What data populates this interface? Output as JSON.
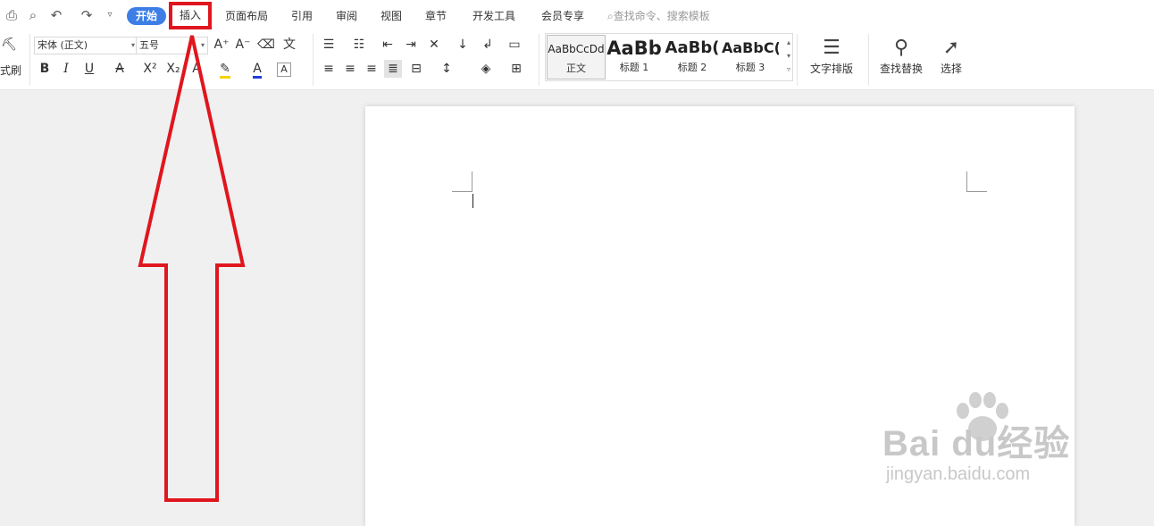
{
  "tabs": {
    "home": "开始",
    "insert": "插入",
    "layout": "页面布局",
    "reference": "引用",
    "review": "审阅",
    "view": "视图",
    "section": "章节",
    "devtools": "开发工具",
    "member": "会员专享"
  },
  "search": {
    "placeholder": "查找命令、搜索模板"
  },
  "ribbon": {
    "format_painter": "式刷",
    "font_name": "宋体 (正文)",
    "font_size": "五号",
    "styles": [
      {
        "preview": "AaBbCcDd",
        "name": "正文"
      },
      {
        "preview": "AaBb",
        "name": "标题 1"
      },
      {
        "preview": "AaBb(",
        "name": "标题 2"
      },
      {
        "preview": "AaBbC(",
        "name": "标题 3"
      }
    ],
    "text_layout": "文字排版",
    "find_replace": "查找替换",
    "select": "选择"
  },
  "watermark": {
    "logo_text": "Bai  du经验",
    "url": "jingyan.baidu.com"
  },
  "colors": {
    "accent": "#3d7ee6",
    "annotation": "#e0161e",
    "highlight": "#f5d200",
    "font_color": "#1f3fd6"
  },
  "icons": [
    "print-icon",
    "print-preview-icon",
    "undo-icon",
    "redo-icon",
    "customize-icon",
    "search-icon"
  ]
}
